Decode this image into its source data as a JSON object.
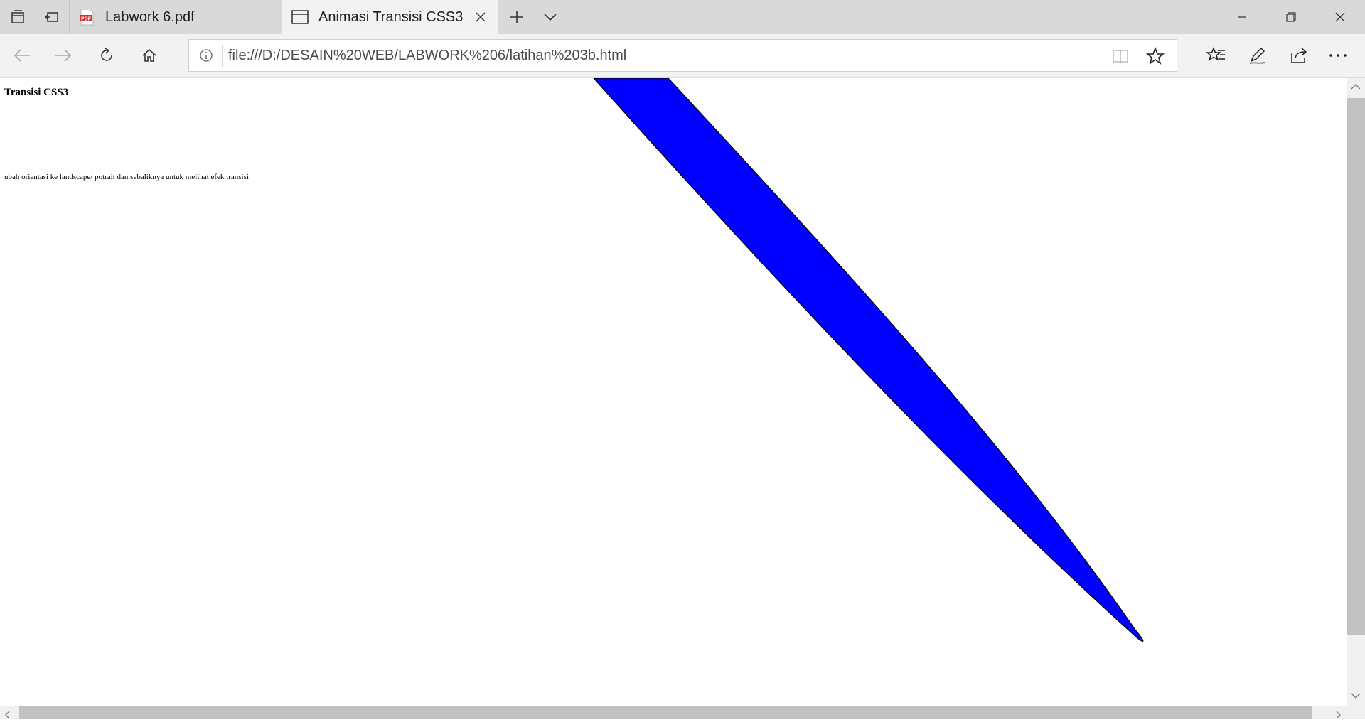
{
  "tabs": [
    {
      "title": "Labwork 6.pdf",
      "icon": "pdf-file-icon",
      "active": false
    },
    {
      "title": "Animasi Transisi CSS3",
      "icon": "page-icon",
      "active": true
    }
  ],
  "address": {
    "url": "file:///D:/DESAIN%20WEB/LABWORK%206/latihan%203b.html"
  },
  "page": {
    "heading": "Transisi CSS3",
    "note": "ubah orientasi ke landscape/ potrait dan sebaliknya untuk melihat efek transisi",
    "shape_color": "#0000ff",
    "shape_outline_color": "#000000"
  },
  "icons": {
    "tab_actions": [
      "tabs-aside-icon",
      "restore-tabs-icon"
    ],
    "new_tab": "plus-icon",
    "tab_list": "chevron-down-icon",
    "window": [
      "minimize-icon",
      "restore-icon",
      "close-icon"
    ],
    "nav": [
      "back-arrow-icon",
      "forward-arrow-icon",
      "refresh-icon",
      "home-icon"
    ],
    "address": [
      "info-icon",
      "reading-view-icon",
      "favorite-star-icon"
    ],
    "toolbar": [
      "favorites-hub-icon",
      "pen-icon",
      "share-icon",
      "more-icon"
    ]
  },
  "colors": {
    "tabbar_bg": "#d9d9d9",
    "active_tab_bg": "#f2f2f2",
    "pdf_badge": "#d0312d"
  }
}
